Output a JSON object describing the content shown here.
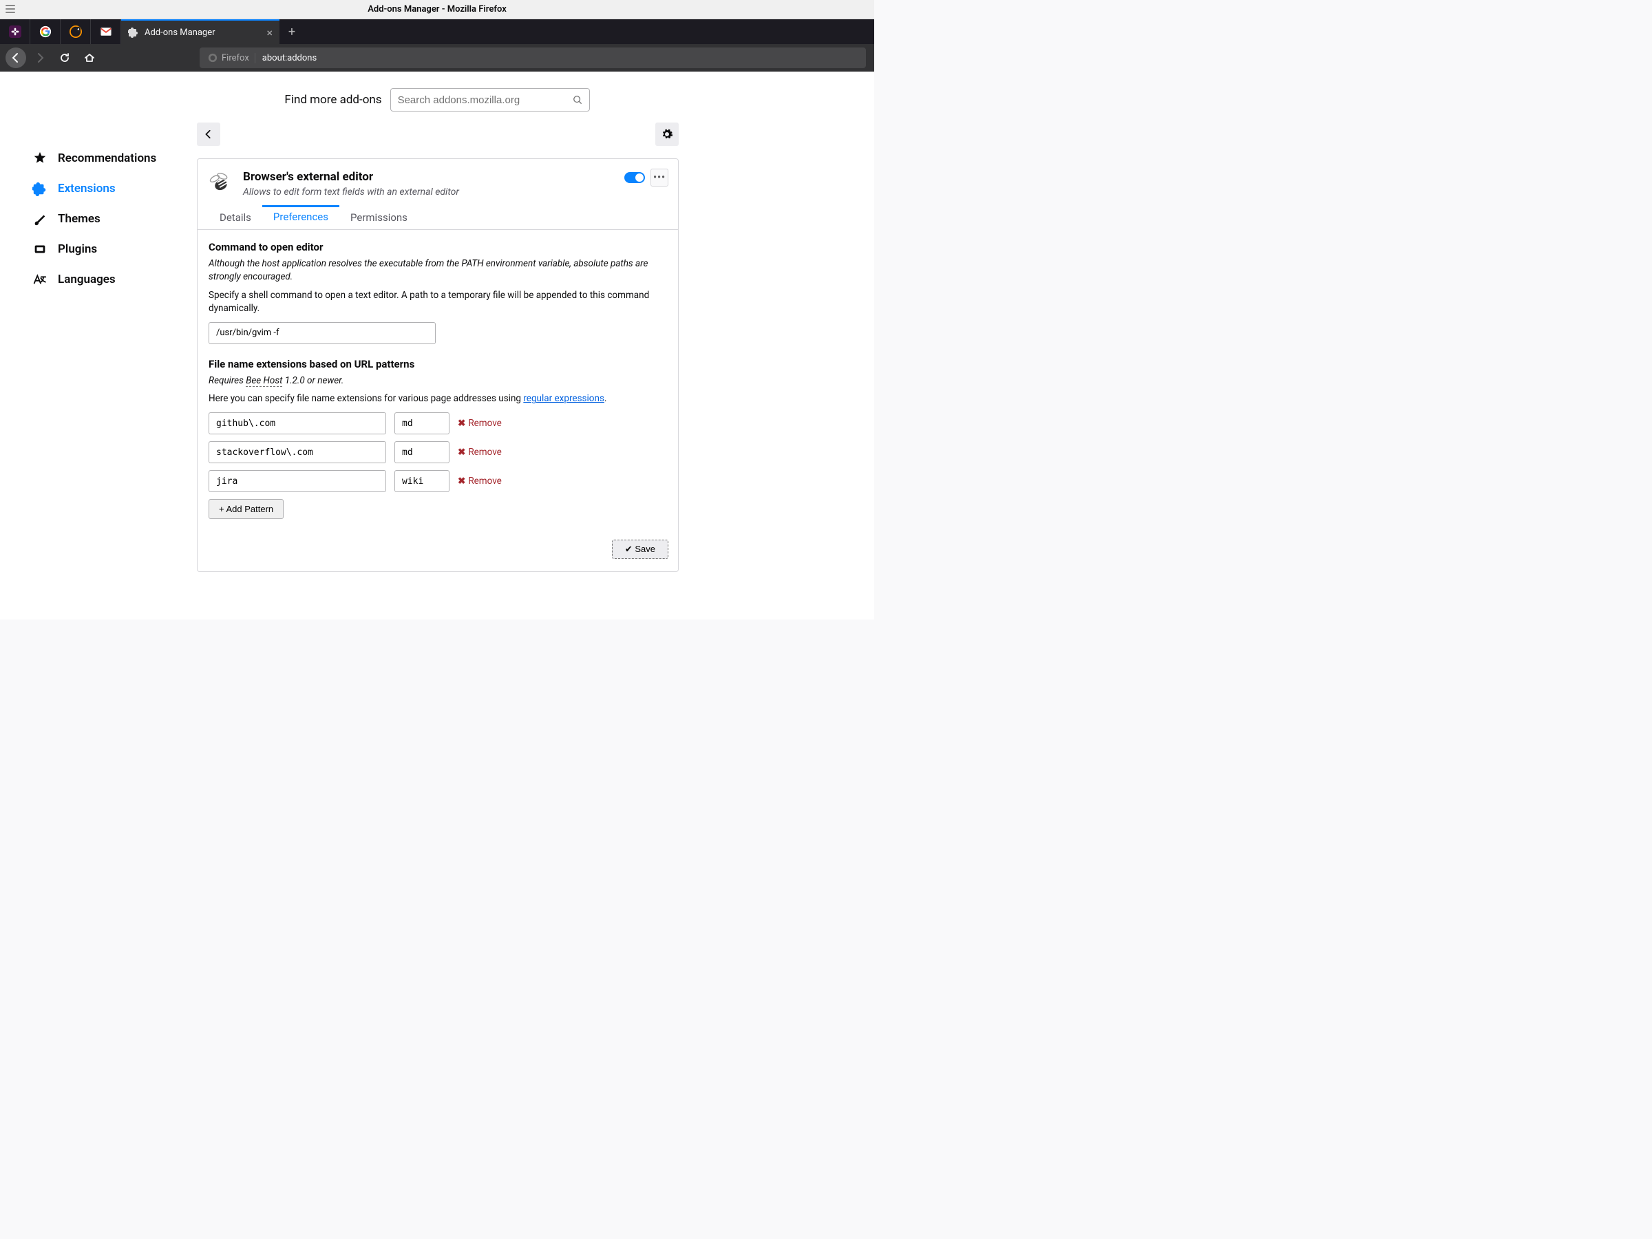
{
  "window": {
    "title": "Add-ons Manager - Mozilla Firefox"
  },
  "tabs": {
    "active_label": "Add-ons Manager"
  },
  "urlbar": {
    "identity_label": "Firefox",
    "url": "about:addons"
  },
  "search": {
    "label": "Find more add-ons",
    "placeholder": "Search addons.mozilla.org"
  },
  "sidebar": {
    "items": [
      {
        "label": "Recommendations"
      },
      {
        "label": "Extensions"
      },
      {
        "label": "Themes"
      },
      {
        "label": "Plugins"
      },
      {
        "label": "Languages"
      }
    ]
  },
  "addon": {
    "name": "Browser's external editor",
    "desc": "Allows to edit form text fields with an external editor",
    "tabs": {
      "details": "Details",
      "preferences": "Preferences",
      "permissions": "Permissions"
    }
  },
  "prefs": {
    "cmd_title": "Command to open editor",
    "cmd_note1": "Although the host application resolves the executable from the PATH environment variable, absolute paths are strongly encouraged.",
    "cmd_note2": "Specify a shell command to open a text editor. A path to a temporary file will be appended to this command dynamically.",
    "cmd_value": "/usr/bin/gvim -f",
    "ext_title": "File name extensions based on URL patterns",
    "ext_requires_prefix": "Requires ",
    "ext_requires_link": "Bee Host",
    "ext_requires_suffix": " 1.2.0 or newer.",
    "ext_help_prefix": "Here you can specify file name extensions for various page addresses using ",
    "ext_help_link": "regular expressions",
    "ext_help_suffix": ".",
    "patterns": [
      {
        "pattern": "github\\.com",
        "ext": "md"
      },
      {
        "pattern": "stackoverflow\\.com",
        "ext": "md"
      },
      {
        "pattern": "jira",
        "ext": "wiki"
      }
    ],
    "remove_label": "Remove",
    "add_label": "+ Add Pattern",
    "save_label": "✔ Save"
  }
}
